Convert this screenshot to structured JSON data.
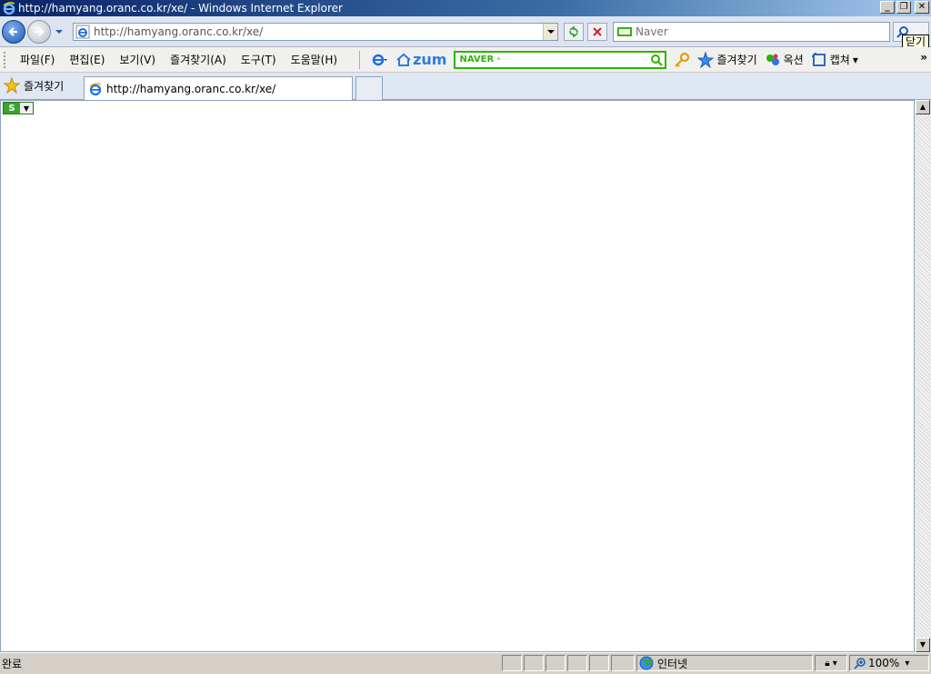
{
  "window": {
    "title": "http://hamyang.oranc.co.kr/xe/ - Windows Internet Explorer",
    "tooltip": "닫기"
  },
  "address": {
    "url": "http://hamyang.oranc.co.kr/xe/"
  },
  "search": {
    "placeholder": "Naver"
  },
  "menu": {
    "items": [
      "파일(F)",
      "편집(E)",
      "보기(V)",
      "즐겨찾기(A)",
      "도구(T)",
      "도움말(H)"
    ]
  },
  "toolbar": {
    "zum_label": "zum",
    "naver_label": "NAVER ·",
    "favorites_label": "즐겨찾기",
    "auction_label": "옥션",
    "capture_label": "캡쳐",
    "more": "»"
  },
  "favbar": {
    "favorites_label": "즐겨찾기"
  },
  "tab": {
    "title": "http://hamyang.oranc.co.kr/xe/"
  },
  "status": {
    "text": "완료",
    "zone": "인터넷",
    "zoom": "100%"
  },
  "colors": {
    "title_bar": "#0a246a",
    "naver_green": "#2db400",
    "zum_blue": "#2a7de1"
  }
}
